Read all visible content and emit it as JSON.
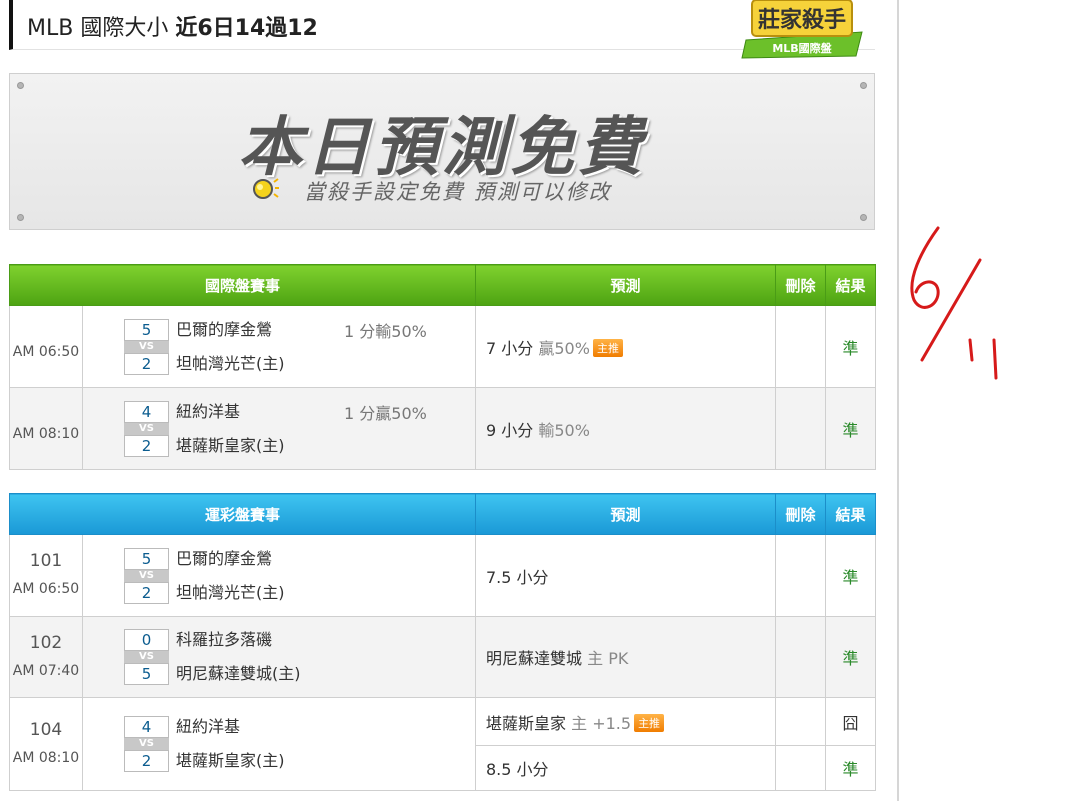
{
  "header": {
    "title_main": "MLB 國際大小",
    "title_sub": "近6日14過12",
    "logo_top": "莊家殺手",
    "logo_bottom": "MLB國際盤"
  },
  "banner": {
    "headline": "本日預測免費",
    "subline": "當殺手設定免費 預測可以修改"
  },
  "intl_table": {
    "headers": [
      "國際盤賽事",
      "預測",
      "刪除",
      "結果"
    ],
    "rows": [
      {
        "time": "AM 06:50",
        "away_score": "5",
        "home_score": "2",
        "vs": "VS",
        "away": "巴爾的摩金鶯",
        "home": "坦帕灣光芒(主)",
        "line": "1 分輸50%",
        "pred_main": "7 小分",
        "pred_extra": "贏50%",
        "badge": "主推",
        "result": "準"
      },
      {
        "time": "AM 08:10",
        "away_score": "4",
        "home_score": "2",
        "vs": "VS",
        "away": "紐約洋基",
        "home": "堪薩斯皇家(主)",
        "line": "1 分贏50%",
        "pred_main": "9 小分",
        "pred_extra": "輸50%",
        "result": "準"
      }
    ]
  },
  "sports_table": {
    "headers": [
      "運彩盤賽事",
      "預測",
      "刪除",
      "結果"
    ],
    "rows": [
      {
        "num": "101",
        "time": "AM 06:50",
        "away_score": "5",
        "home_score": "2",
        "vs": "VS",
        "away": "巴爾的摩金鶯",
        "home": "坦帕灣光芒(主)",
        "pred_main": "7.5 小分",
        "result": "準"
      },
      {
        "num": "102",
        "time": "AM 07:40",
        "away_score": "0",
        "home_score": "5",
        "vs": "VS",
        "away": "科羅拉多落磯",
        "home": "明尼蘇達雙城(主)",
        "pred_main": "明尼蘇達雙城",
        "pred_extra": "主 PK",
        "result": "準"
      },
      {
        "num": "104",
        "time": "AM 08:10",
        "away_score": "4",
        "home_score": "2",
        "vs": "VS",
        "away": "紐約洋基",
        "home": "堪薩斯皇家(主)",
        "pred_main": "堪薩斯皇家",
        "pred_extra": "主 +1.5",
        "badge": "主推",
        "result": "囧",
        "pred2_main": "8.5 小分",
        "result2": "準"
      }
    ]
  },
  "colors": {
    "green_header": "#5cb21c",
    "blue_header": "#24a8e0",
    "win": "#2a8a2a",
    "badge": "#f07c00",
    "annotation": "#d61a1a"
  }
}
